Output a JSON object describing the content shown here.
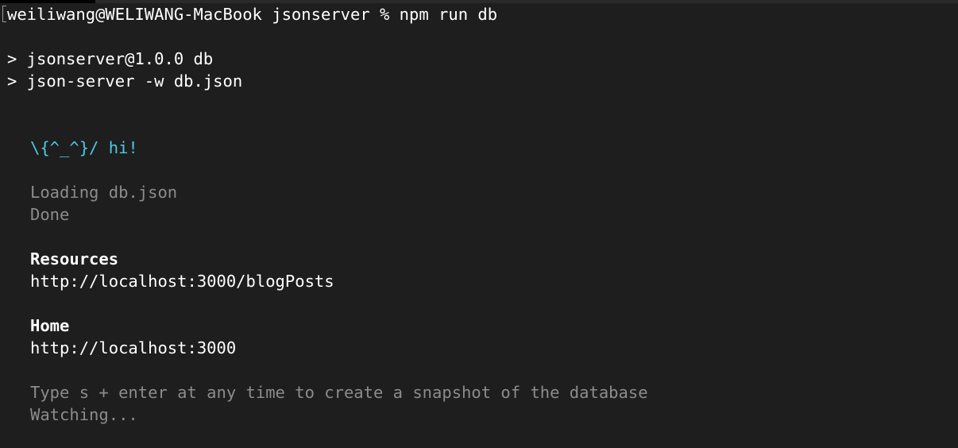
{
  "terminal": {
    "prompt_line": "weiliwang@WELIWANG-MacBook jsonserver % npm run db",
    "npm_lines": [
      "> jsonserver@1.0.0 db",
      "> json-server -w db.json"
    ],
    "greeting": "\\{^_^}/ hi!",
    "loading": "Loading db.json",
    "done": "Done",
    "resources_heading": "Resources",
    "resources_url": "http://localhost:3000/blogPosts",
    "home_heading": "Home",
    "home_url": "http://localhost:3000",
    "snapshot_hint": "Type s + enter at any time to create a snapshot of the database",
    "watching": "Watching..."
  }
}
